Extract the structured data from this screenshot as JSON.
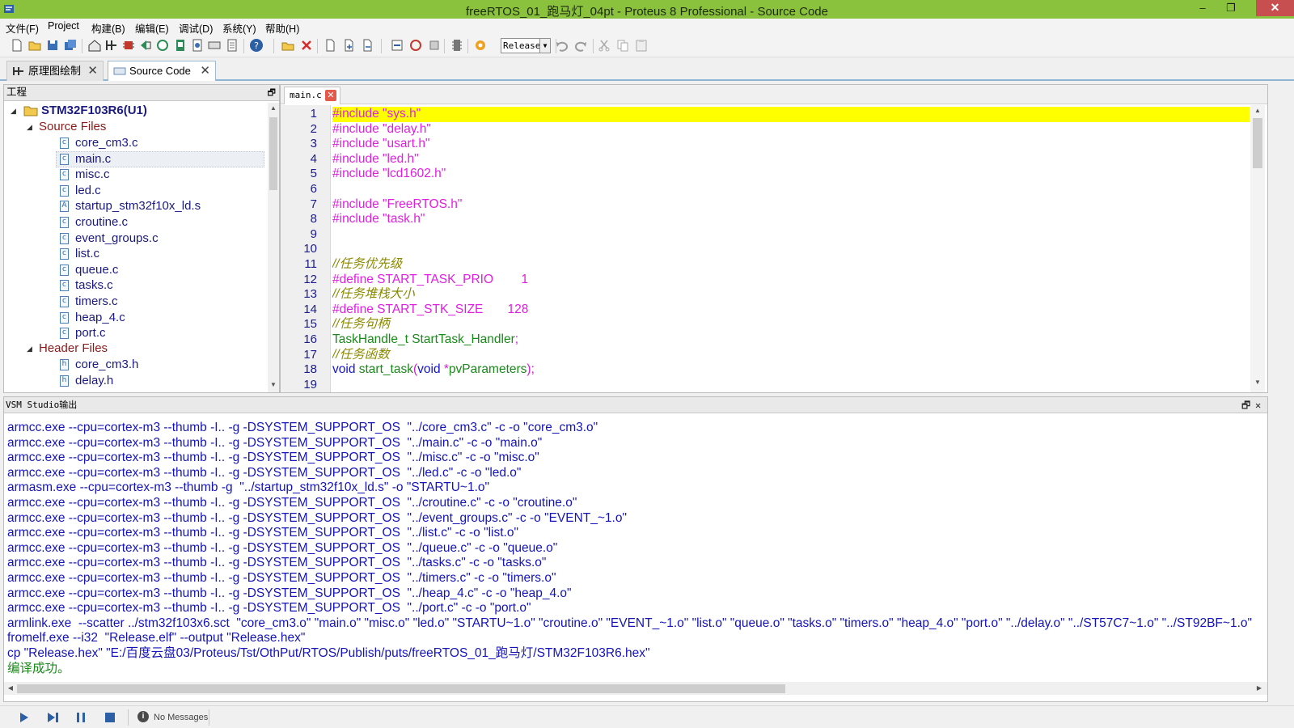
{
  "window": {
    "title": "freeRTOS_01_跑马灯_04pt - Proteus 8 Professional - Source Code",
    "minimize": "–",
    "restore": "❐",
    "close": "✕"
  },
  "menu": [
    "文件(F)",
    "Project",
    "构建(B)",
    "编辑(E)",
    "调试(D)",
    "系统(Y)",
    "帮助(H)"
  ],
  "toolbar": {
    "build_config": "Release"
  },
  "doc_tabs": [
    {
      "label": "原理图绘制",
      "close": "✕"
    },
    {
      "label": "Source Code",
      "close": "✕"
    }
  ],
  "project_panel": {
    "title": "工程",
    "restore": "🗗",
    "root": "STM32F103R6(U1)",
    "groups": [
      {
        "name": "Source Files",
        "files": [
          "core_cm3.c",
          "main.c",
          "misc.c",
          "led.c",
          "startup_stm32f10x_ld.s",
          "croutine.c",
          "event_groups.c",
          "list.c",
          "queue.c",
          "tasks.c",
          "timers.c",
          "heap_4.c",
          "port.c"
        ]
      },
      {
        "name": "Header Files",
        "files": [
          "core_cm3.h",
          "delay.h"
        ]
      }
    ],
    "selected_file": "main.c"
  },
  "editor": {
    "tab": "main.c",
    "tab_close": "✕",
    "line_numbers": [
      "1",
      "2",
      "3",
      "4",
      "5",
      "6",
      "7",
      "8",
      "9",
      "10",
      "11",
      "12",
      "13",
      "14",
      "15",
      "16",
      "17",
      "18",
      "19"
    ],
    "lines": [
      "#include \"sys.h\"",
      "#include \"delay.h\"",
      "#include \"usart.h\"",
      "#include \"led.h\"",
      "#include \"lcd1602.h\"",
      "",
      "#include \"FreeRTOS.h\"",
      "#include \"task.h\"",
      "",
      "",
      "//任务优先级",
      "#define START_TASK_PRIO        1",
      "//任务堆栈大小",
      "#define START_STK_SIZE       128",
      "//任务句柄",
      "TaskHandle_t StartTask_Handler;",
      "//任务函数",
      "void start_task(void *pvParameters);"
    ]
  },
  "output_panel": {
    "title": "VSM Studio输出",
    "restore": "🗗",
    "close": "✕",
    "lines": [
      "armcc.exe --cpu=cortex-m3 --thumb -I.. -g -DSYSTEM_SUPPORT_OS  \"../core_cm3.c\" -c -o \"core_cm3.o\"",
      "armcc.exe --cpu=cortex-m3 --thumb -I.. -g -DSYSTEM_SUPPORT_OS  \"../main.c\" -c -o \"main.o\"",
      "armcc.exe --cpu=cortex-m3 --thumb -I.. -g -DSYSTEM_SUPPORT_OS  \"../misc.c\" -c -o \"misc.o\"",
      "armcc.exe --cpu=cortex-m3 --thumb -I.. -g -DSYSTEM_SUPPORT_OS  \"../led.c\" -c -o \"led.o\"",
      "armasm.exe --cpu=cortex-m3 --thumb -g  \"../startup_stm32f10x_ld.s\" -o \"STARTU~1.o\"",
      "armcc.exe --cpu=cortex-m3 --thumb -I.. -g -DSYSTEM_SUPPORT_OS  \"../croutine.c\" -c -o \"croutine.o\"",
      "armcc.exe --cpu=cortex-m3 --thumb -I.. -g -DSYSTEM_SUPPORT_OS  \"../event_groups.c\" -c -o \"EVENT_~1.o\"",
      "armcc.exe --cpu=cortex-m3 --thumb -I.. -g -DSYSTEM_SUPPORT_OS  \"../list.c\" -c -o \"list.o\"",
      "armcc.exe --cpu=cortex-m3 --thumb -I.. -g -DSYSTEM_SUPPORT_OS  \"../queue.c\" -c -o \"queue.o\"",
      "armcc.exe --cpu=cortex-m3 --thumb -I.. -g -DSYSTEM_SUPPORT_OS  \"../tasks.c\" -c -o \"tasks.o\"",
      "armcc.exe --cpu=cortex-m3 --thumb -I.. -g -DSYSTEM_SUPPORT_OS  \"../timers.c\" -c -o \"timers.o\"",
      "armcc.exe --cpu=cortex-m3 --thumb -I.. -g -DSYSTEM_SUPPORT_OS  \"../heap_4.c\" -c -o \"heap_4.o\"",
      "armcc.exe --cpu=cortex-m3 --thumb -I.. -g -DSYSTEM_SUPPORT_OS  \"../port.c\" -c -o \"port.o\"",
      "armlink.exe  --scatter ../stm32f103x6.sct  \"core_cm3.o\" \"main.o\" \"misc.o\" \"led.o\" \"STARTU~1.o\" \"croutine.o\" \"EVENT_~1.o\" \"list.o\" \"queue.o\" \"tasks.o\" \"timers.o\" \"heap_4.o\" \"port.o\" \"../delay.o\" \"../ST57C7~1.o\" \"../ST92BF~1.o\"",
      "fromelf.exe --i32  \"Release.elf\" --output \"Release.hex\"",
      "cp \"Release.hex\" \"E:/百度云盘03/Proteus/Tst/OthPut/RTOS/Publish/puts/freeRTOS_01_跑马灯/STM32F103R6.hex\"",
      "编译成功。"
    ]
  },
  "status": {
    "message": "No Messages"
  },
  "colors": {
    "titlebar": "#8ac23d",
    "line_highlight": "#ffff00",
    "preprocessor": "#e020e0",
    "comment": "#8a8a00",
    "output_text": "#1414b8",
    "success_text": "#1a8a1a"
  }
}
